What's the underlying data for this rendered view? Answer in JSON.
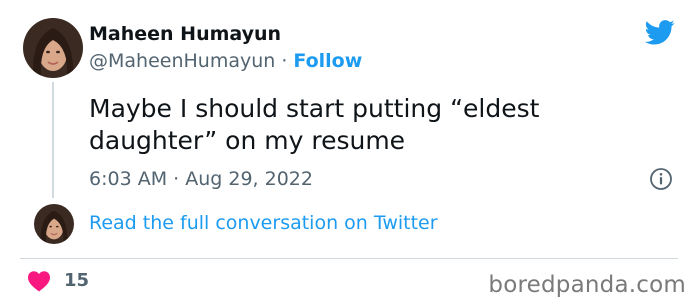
{
  "author": {
    "name": "Maheen Humayun",
    "handle": "@MaheenHumayun",
    "separator": "·",
    "follow_label": "Follow"
  },
  "tweet": {
    "text": "Maybe I should start putting “eldest daughter” on my resume",
    "timestamp": "6:03 AM · Aug 29, 2022"
  },
  "conversation_link": "Read the full conversation on Twitter",
  "likes_count": "15",
  "watermark": "boredpanda.com",
  "icons": {
    "brand": "twitter-bird-icon",
    "info": "info-icon",
    "like": "heart-icon"
  },
  "colors": {
    "accent": "#1d9bf0",
    "like": "#f91880",
    "text": "#0f1419",
    "muted": "#536471"
  }
}
